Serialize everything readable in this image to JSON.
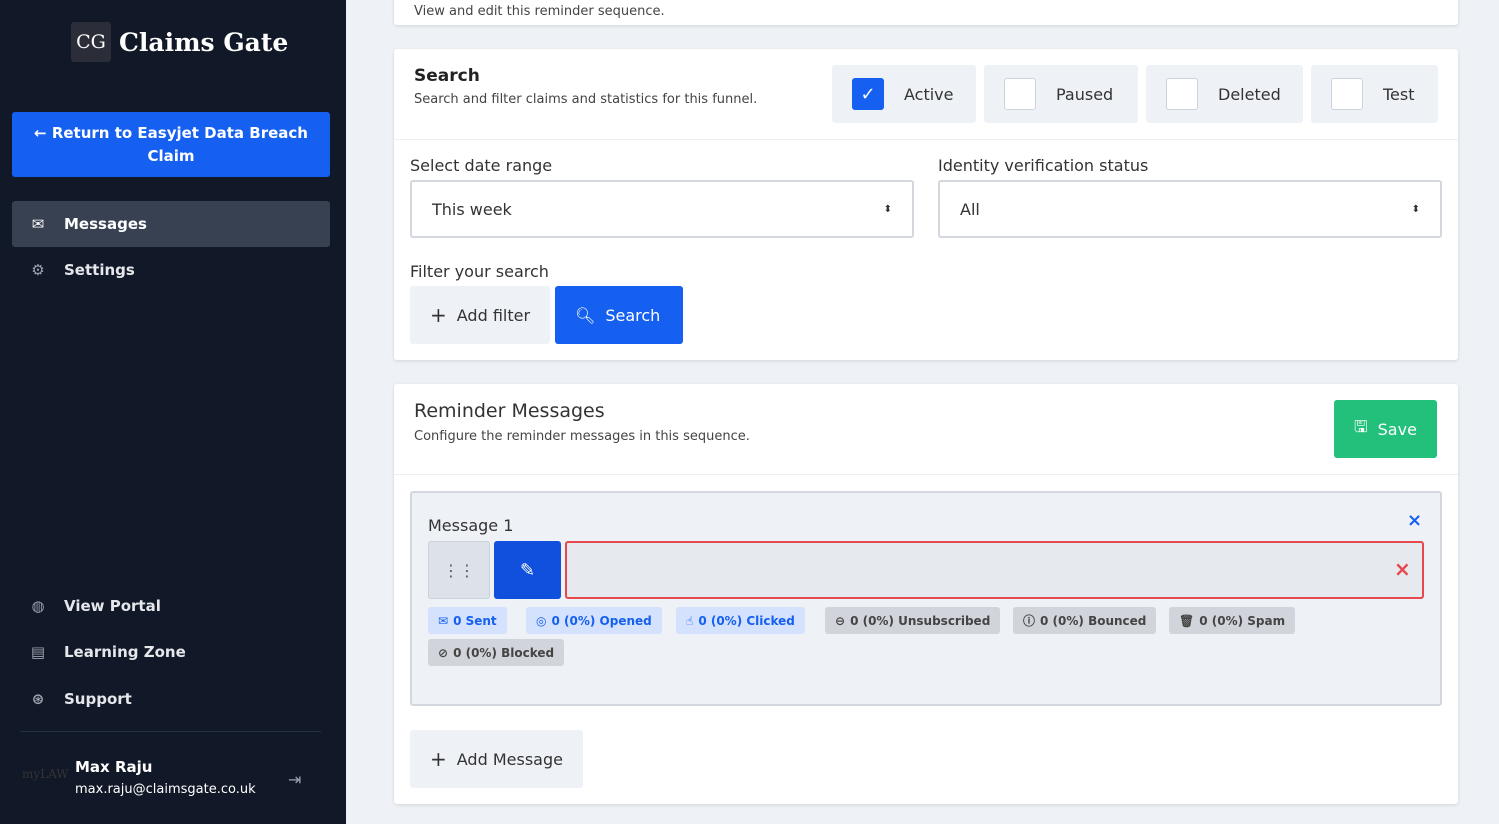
{
  "brand": {
    "logo_mark": "CG",
    "name": "Claims Gate"
  },
  "sidebar": {
    "return_label": "Return to Easyjet Data Breach Claim",
    "items": [
      {
        "label": "Messages",
        "icon": "envelope-icon"
      },
      {
        "label": "Settings",
        "icon": "gear-icon"
      }
    ],
    "bottom_items": [
      {
        "label": "View Portal",
        "icon": "globe-icon"
      },
      {
        "label": "Learning Zone",
        "icon": "book-icon"
      },
      {
        "label": "Support",
        "icon": "lifebuoy-icon"
      }
    ],
    "user": {
      "logo": "myLAW",
      "name": "Max Raju",
      "email": "max.raju@claimsgate.co.uk"
    }
  },
  "top_card": {
    "subtitle": "View and edit this reminder sequence."
  },
  "search": {
    "title": "Search",
    "subtitle": "Search and filter claims and statistics for this funnel.",
    "statuses": [
      {
        "label": "Active",
        "checked": true
      },
      {
        "label": "Paused",
        "checked": false
      },
      {
        "label": "Deleted",
        "checked": false
      },
      {
        "label": "Test",
        "checked": false
      }
    ],
    "date_label": "Select date range",
    "date_value": "This week",
    "idv_label": "Identity verification status",
    "idv_value": "All",
    "filter_label": "Filter your search",
    "add_filter": "Add filter",
    "search_button": "Search"
  },
  "reminders": {
    "title": "Reminder Messages",
    "subtitle": "Configure the reminder messages in this sequence.",
    "save": "Save",
    "message": {
      "title": "Message 1",
      "stats": [
        "0 Sent",
        "0 (0%) Opened",
        "0 (0%) Clicked",
        "0 (0%) Unsubscribed",
        "0 (0%) Bounced",
        "0 (0%) Spam",
        "0 (0%) Blocked"
      ]
    },
    "add_message": "Add Message"
  },
  "colors": {
    "primary": "#1560f0",
    "success": "#22c07a",
    "sidebar": "#111827",
    "error": "#e5484d"
  }
}
